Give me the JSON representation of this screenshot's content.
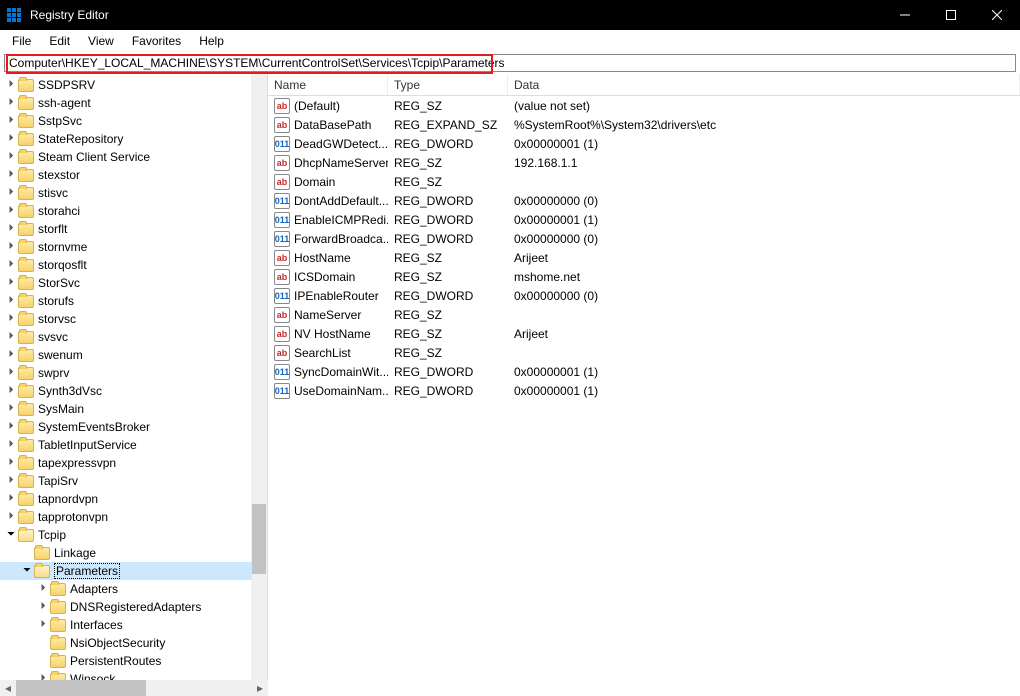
{
  "window": {
    "title": "Registry Editor"
  },
  "menu": {
    "file": "File",
    "edit": "Edit",
    "view": "View",
    "favorites": "Favorites",
    "help": "Help"
  },
  "address": "Computer\\HKEY_LOCAL_MACHINE\\SYSTEM\\CurrentControlSet\\Services\\Tcpip\\Parameters",
  "columns": {
    "name": "Name",
    "type": "Type",
    "data": "Data"
  },
  "tree": {
    "before": [
      {
        "label": "SSDPSRV",
        "expandable": true
      },
      {
        "label": "ssh-agent",
        "expandable": true
      },
      {
        "label": "SstpSvc",
        "expandable": true
      },
      {
        "label": "StateRepository",
        "expandable": true
      },
      {
        "label": "Steam Client Service",
        "expandable": true
      },
      {
        "label": "stexstor",
        "expandable": true
      },
      {
        "label": "stisvc",
        "expandable": true
      },
      {
        "label": "storahci",
        "expandable": true
      },
      {
        "label": "storflt",
        "expandable": true
      },
      {
        "label": "stornvme",
        "expandable": true
      },
      {
        "label": "storqosflt",
        "expandable": true
      },
      {
        "label": "StorSvc",
        "expandable": true
      },
      {
        "label": "storufs",
        "expandable": true
      },
      {
        "label": "storvsc",
        "expandable": true
      },
      {
        "label": "svsvc",
        "expandable": true
      },
      {
        "label": "swenum",
        "expandable": true
      },
      {
        "label": "swprv",
        "expandable": true
      },
      {
        "label": "Synth3dVsc",
        "expandable": true
      },
      {
        "label": "SysMain",
        "expandable": true
      },
      {
        "label": "SystemEventsBroker",
        "expandable": true
      },
      {
        "label": "TabletInputService",
        "expandable": true
      },
      {
        "label": "tapexpressvpn",
        "expandable": true
      },
      {
        "label": "TapiSrv",
        "expandable": true
      },
      {
        "label": "tapnordvpn",
        "expandable": true
      },
      {
        "label": "tapprotonvpn",
        "expandable": true
      }
    ],
    "tcpip_label": "Tcpip",
    "linkage_label": "Linkage",
    "parameters_label": "Parameters",
    "params_children": [
      {
        "label": "Adapters",
        "expandable": true
      },
      {
        "label": "DNSRegisteredAdapters",
        "expandable": true
      },
      {
        "label": "Interfaces",
        "expandable": true
      },
      {
        "label": "NsiObjectSecurity",
        "expandable": false
      },
      {
        "label": "PersistentRoutes",
        "expandable": false
      },
      {
        "label": "Winsock",
        "expandable": true
      }
    ]
  },
  "values": [
    {
      "name": "(Default)",
      "type": "REG_SZ",
      "data": "(value not set)",
      "icon": "sz"
    },
    {
      "name": "DataBasePath",
      "type": "REG_EXPAND_SZ",
      "data": "%SystemRoot%\\System32\\drivers\\etc",
      "icon": "sz"
    },
    {
      "name": "DeadGWDetect...",
      "type": "REG_DWORD",
      "data": "0x00000001 (1)",
      "icon": "dw"
    },
    {
      "name": "DhcpNameServer",
      "type": "REG_SZ",
      "data": "192.168.1.1",
      "icon": "sz"
    },
    {
      "name": "Domain",
      "type": "REG_SZ",
      "data": "",
      "icon": "sz"
    },
    {
      "name": "DontAddDefault...",
      "type": "REG_DWORD",
      "data": "0x00000000 (0)",
      "icon": "dw"
    },
    {
      "name": "EnableICMPRedi...",
      "type": "REG_DWORD",
      "data": "0x00000001 (1)",
      "icon": "dw"
    },
    {
      "name": "ForwardBroadca...",
      "type": "REG_DWORD",
      "data": "0x00000000 (0)",
      "icon": "dw"
    },
    {
      "name": "HostName",
      "type": "REG_SZ",
      "data": "Arijeet",
      "icon": "sz"
    },
    {
      "name": "ICSDomain",
      "type": "REG_SZ",
      "data": "mshome.net",
      "icon": "sz"
    },
    {
      "name": "IPEnableRouter",
      "type": "REG_DWORD",
      "data": "0x00000000 (0)",
      "icon": "dw"
    },
    {
      "name": "NameServer",
      "type": "REG_SZ",
      "data": "",
      "icon": "sz"
    },
    {
      "name": "NV HostName",
      "type": "REG_SZ",
      "data": "Arijeet",
      "icon": "sz"
    },
    {
      "name": "SearchList",
      "type": "REG_SZ",
      "data": "",
      "icon": "sz"
    },
    {
      "name": "SyncDomainWit...",
      "type": "REG_DWORD",
      "data": "0x00000001 (1)",
      "icon": "dw"
    },
    {
      "name": "UseDomainNam...",
      "type": "REG_DWORD",
      "data": "0x00000001 (1)",
      "icon": "dw"
    }
  ]
}
